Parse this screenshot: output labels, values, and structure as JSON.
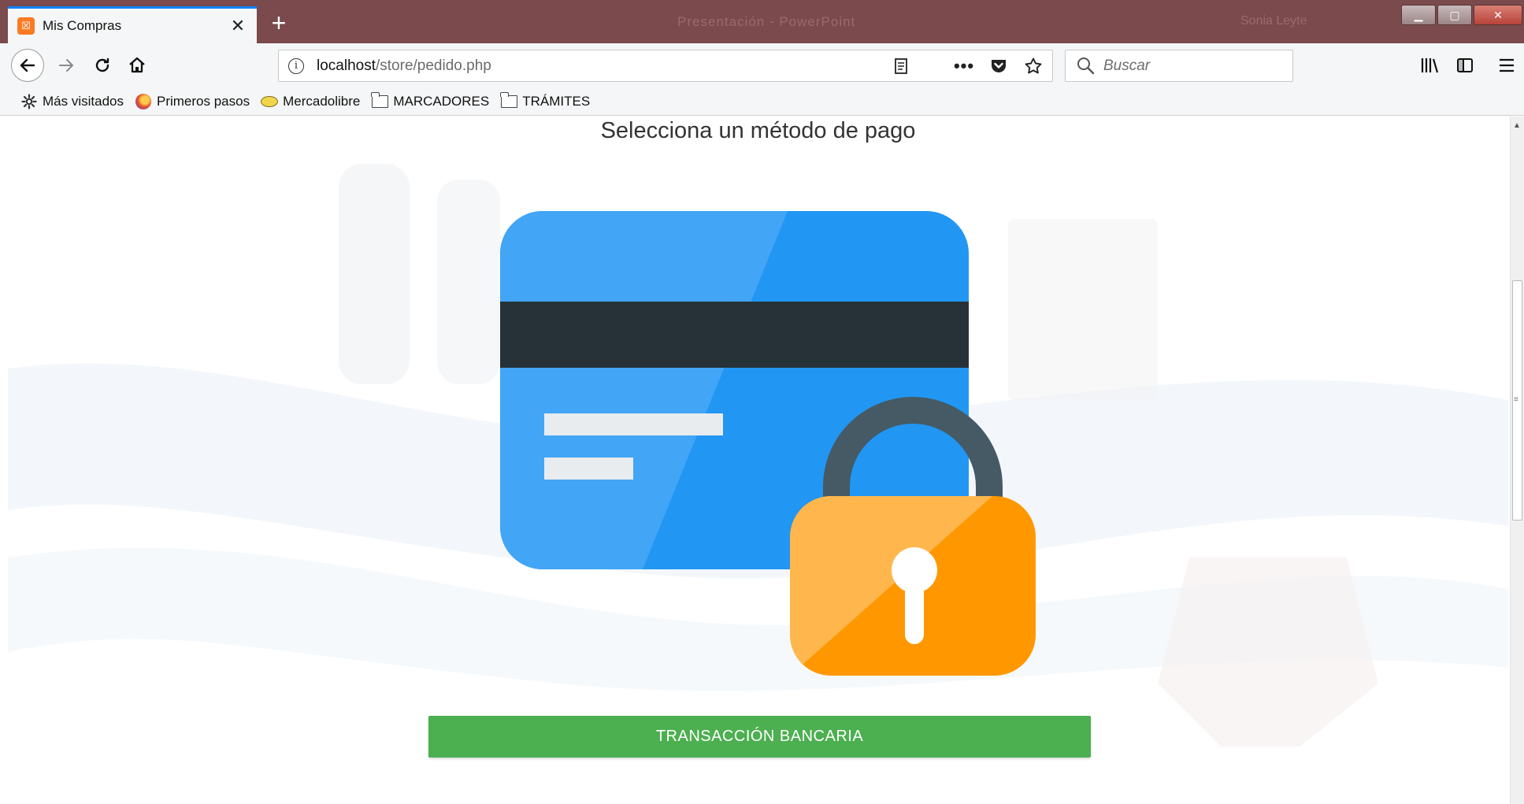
{
  "browser": {
    "tab": {
      "title": "Mis Compras",
      "favicon": "xampp-icon"
    },
    "window_title": "Presentación - PowerPoint",
    "window_user": "Sonia Leyte",
    "url": {
      "host": "localhost",
      "path": "/store/pedido.php"
    },
    "search": {
      "placeholder": "Buscar"
    },
    "bookmarks": [
      {
        "label": "Más visitados",
        "icon": "gear-icon"
      },
      {
        "label": "Primeros pasos",
        "icon": "firefox-icon"
      },
      {
        "label": "Mercadolibre",
        "icon": "mercadolibre-icon"
      },
      {
        "label": "MARCADORES",
        "icon": "folder-icon"
      },
      {
        "label": "TRÁMITES",
        "icon": "folder-icon"
      }
    ],
    "colors": {
      "titlebar": "#7a4a4c",
      "toolbar": "#f5f6f7",
      "tab_accent": "#0a84ff"
    }
  },
  "page": {
    "heading": "Selecciona un método de pago",
    "payment_button": "TRANSACCIÓN BANCARIA",
    "colors": {
      "card": "#2196f3",
      "card_highlight": "#42a5f5",
      "stripe": "#263238",
      "lock_body": "#ff9800",
      "lock_highlight": "#ffb74d",
      "shackle": "#455a64",
      "button": "#4caf50"
    }
  }
}
